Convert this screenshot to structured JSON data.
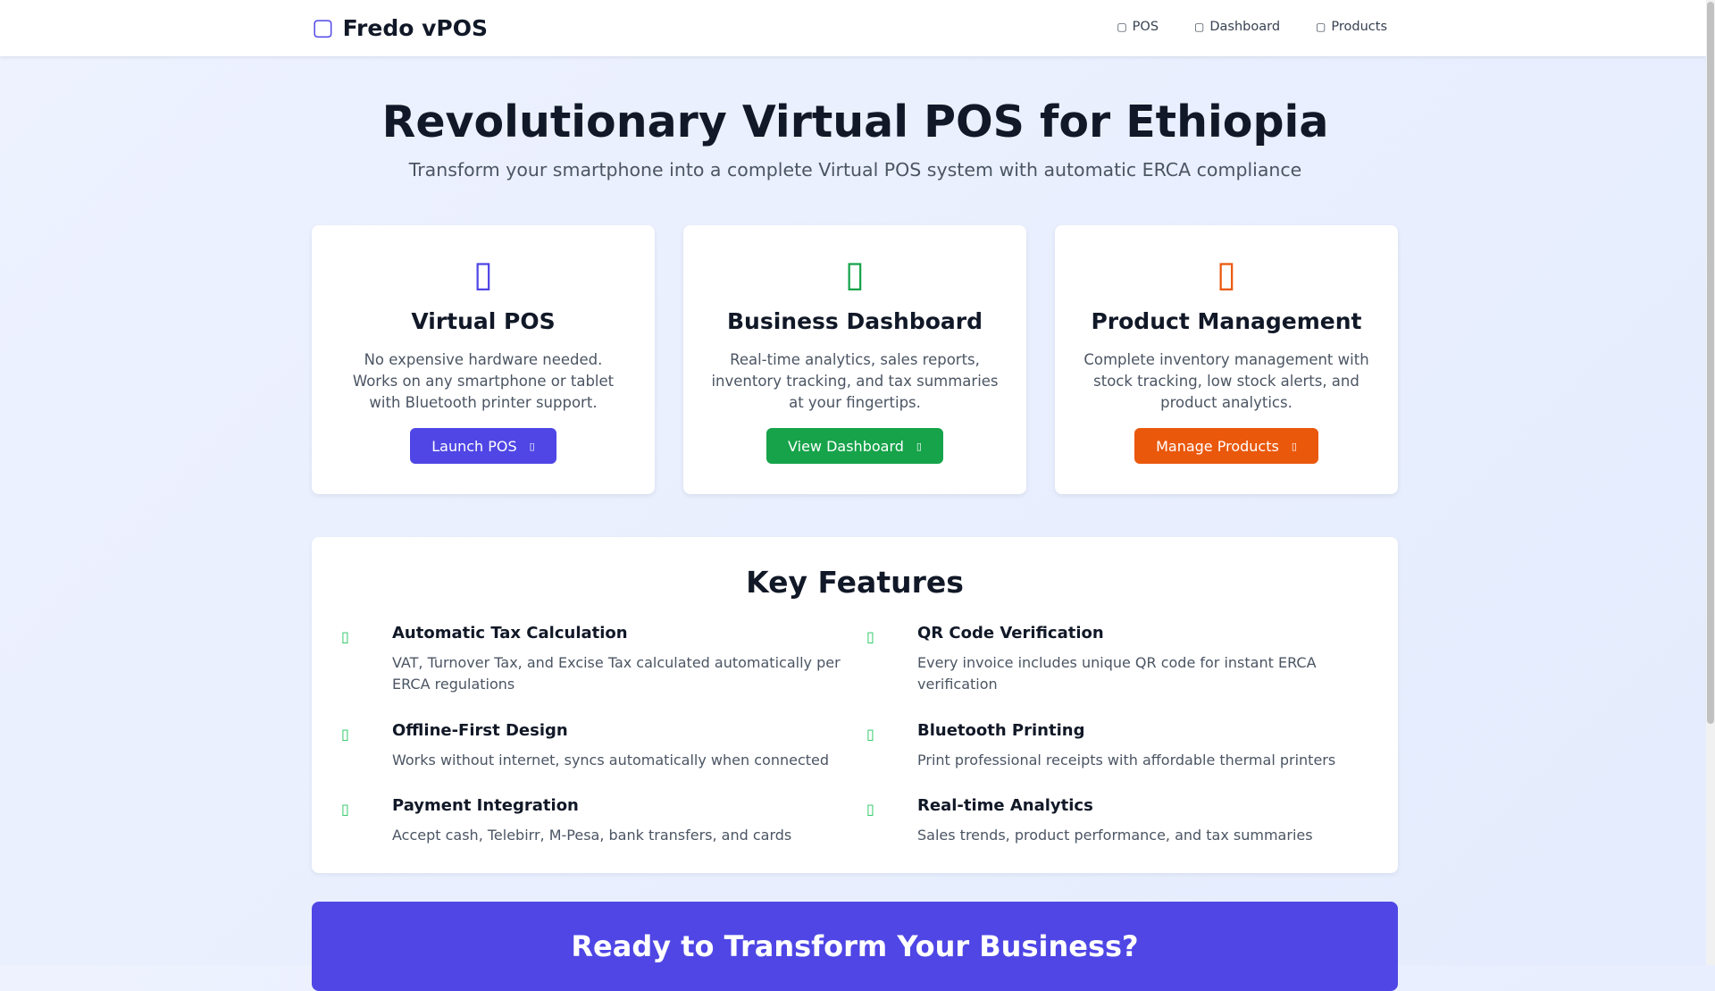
{
  "nav": {
    "brand_icon": "cash-register-icon",
    "brand": "Fredo vPOS",
    "links": [
      {
        "icon": "pos-icon",
        "label": "POS"
      },
      {
        "icon": "chart-icon",
        "label": "Dashboard"
      },
      {
        "icon": "box-icon",
        "label": "Products"
      }
    ]
  },
  "hero": {
    "title": "Revolutionary Virtual POS for Ethiopia",
    "subtitle": "Transform your smartphone into a complete Virtual POS system with automatic ERCA compliance"
  },
  "cards": [
    {
      "icon": "mobile-icon",
      "color": "#4f46e5",
      "title": "Virtual POS",
      "description": "No expensive hardware needed. Works on any smartphone or tablet with Bluetooth printer support.",
      "button": "Launch POS",
      "button_color": "#4f46e5"
    },
    {
      "icon": "chart-icon",
      "color": "#16a34a",
      "title": "Business Dashboard",
      "description": "Real-time analytics, sales reports, inventory tracking, and tax summaries at your fingertips.",
      "button": "View Dashboard",
      "button_color": "#16a34a"
    },
    {
      "icon": "boxes-icon",
      "color": "#ea580c",
      "title": "Product Management",
      "description": "Complete inventory management with stock tracking, low stock alerts, and product analytics.",
      "button": "Manage Products",
      "button_color": "#ea580c"
    }
  ],
  "features": {
    "title": "Key Features",
    "check_color": "#22c55e",
    "items": [
      {
        "title": "Automatic Tax Calculation",
        "description": "VAT, Turnover Tax, and Excise Tax calculated automatically per ERCA regulations"
      },
      {
        "title": "QR Code Verification",
        "description": "Every invoice includes unique QR code for instant ERCA verification"
      },
      {
        "title": "Offline-First Design",
        "description": "Works without internet, syncs automatically when connected"
      },
      {
        "title": "Bluetooth Printing",
        "description": "Print professional receipts with affordable thermal printers"
      },
      {
        "title": "Payment Integration",
        "description": "Accept cash, Telebirr, M-Pesa, bank transfers, and cards"
      },
      {
        "title": "Real-time Analytics",
        "description": "Sales trends, product performance, and tax summaries"
      }
    ]
  },
  "cta": {
    "title": "Ready to Transform Your Business?",
    "background": "#4f46e5"
  }
}
